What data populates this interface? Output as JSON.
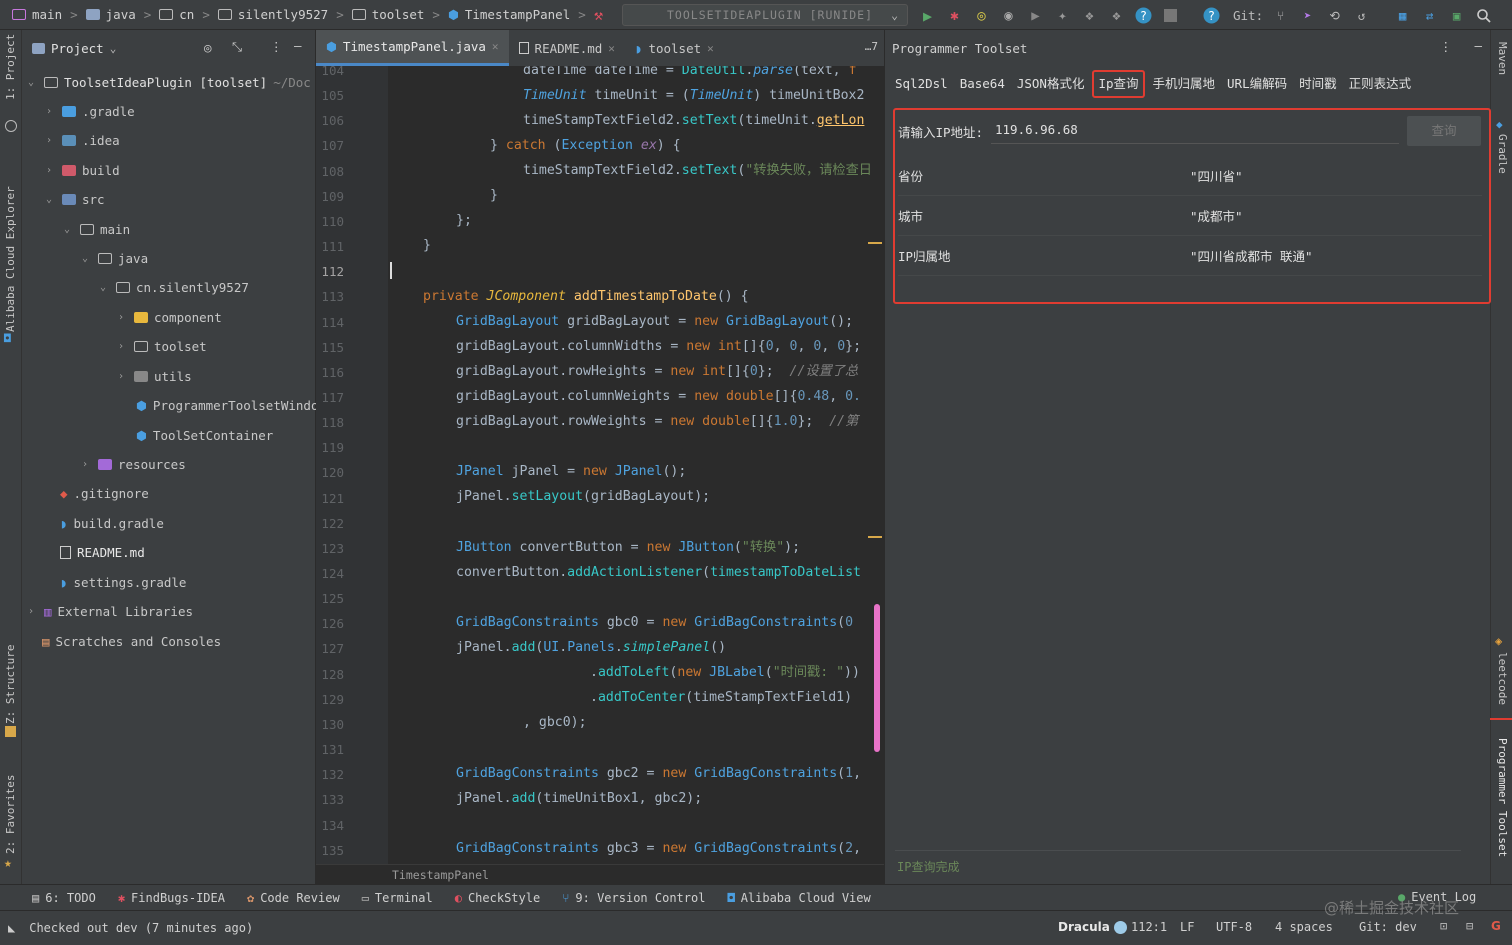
{
  "breadcrumb": {
    "items": [
      "main",
      "java",
      "cn",
      "silently9527",
      "toolset",
      "TimestampPanel"
    ]
  },
  "run_config": {
    "label": "TOOLSETIDEAPLUGIN [RUNIDE]"
  },
  "toolbar": {
    "git_label": "Git:"
  },
  "left_strip": {
    "project": "1: Project",
    "alibaba": "Alibaba Cloud Explorer",
    "structure": "Z: Structure",
    "favorites": "2: Favorites"
  },
  "right_strip": {
    "maven": "Maven",
    "gradle": "Gradle",
    "leetcode": "leetcode",
    "programmer_toolset": "Programmer Toolset"
  },
  "project_panel": {
    "title": "Project",
    "tree": [
      {
        "label": "ToolsetIdeaPlugin [toolset]",
        "suffix": "~/Doc"
      },
      {
        "label": ".gradle"
      },
      {
        "label": ".idea"
      },
      {
        "label": "build"
      },
      {
        "label": "src"
      },
      {
        "label": "main"
      },
      {
        "label": "java"
      },
      {
        "label": "cn.silently9527"
      },
      {
        "label": "component"
      },
      {
        "label": "toolset"
      },
      {
        "label": "utils"
      },
      {
        "label": "ProgrammerToolsetWindo"
      },
      {
        "label": "ToolSetContainer"
      },
      {
        "label": "resources"
      },
      {
        "label": ".gitignore"
      },
      {
        "label": "build.gradle"
      },
      {
        "label": "README.md"
      },
      {
        "label": "settings.gradle"
      },
      {
        "label": "External Libraries"
      },
      {
        "label": "Scratches and Consoles"
      }
    ]
  },
  "editor": {
    "tabs": [
      {
        "label": "TimestampPanel.java"
      },
      {
        "label": "README.md"
      },
      {
        "label": "toolset"
      }
    ],
    "more": "…7",
    "breadcrumb": "TimestampPanel",
    "line_numbers": [
      "104",
      "105",
      "106",
      "107",
      "108",
      "109",
      "110",
      "111",
      "112",
      "113",
      "114",
      "115",
      "116",
      "117",
      "118",
      "119",
      "120",
      "121",
      "122",
      "123",
      "124",
      "125",
      "126",
      "127",
      "128",
      "129",
      "130",
      "131",
      "132",
      "133",
      "134",
      "135"
    ]
  },
  "toolset": {
    "title": "Programmer Toolset",
    "tabs": [
      "Sql2Dsl",
      "Base64",
      "JSON格式化",
      "Ip查询",
      "手机归属地",
      "URL编解码",
      "时间戳",
      "正则表达式"
    ],
    "ip_label": "请输入IP地址:",
    "ip_value": "119.6.96.68",
    "query_button": "查询",
    "rows": [
      {
        "key": "省份",
        "value": "\"四川省\""
      },
      {
        "key": "城市",
        "value": "\"成都市\""
      },
      {
        "key": "IP归属地",
        "value": "\"四川省成都市 联通\""
      }
    ],
    "status": "IP查询完成"
  },
  "bottom_tools": {
    "todo": "6: TODO",
    "findbugs": "FindBugs-IDEA",
    "code_review": "Code Review",
    "terminal": "Terminal",
    "checkstyle": "CheckStyle",
    "version_control": "9: Version Control",
    "alibaba_cloud": "Alibaba Cloud View",
    "event_log": "Event Log"
  },
  "status": {
    "message": "Checked out dev (7 minutes ago)",
    "theme": "Dracula",
    "position": "112:1",
    "line_sep": "LF",
    "encoding": "UTF-8",
    "indent": "4 spaces",
    "git": "Git: dev"
  },
  "watermark": "@稀土掘金技术社区",
  "colors": {
    "accent_red": "#e03c31",
    "background": "#2b2b2b",
    "panel": "#3c3f41"
  }
}
